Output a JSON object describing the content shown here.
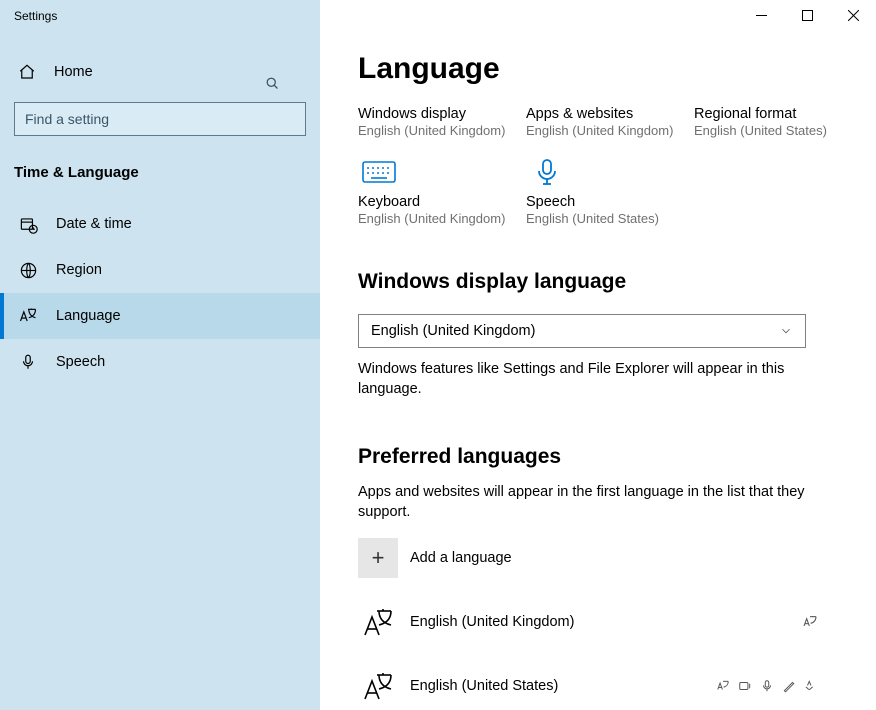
{
  "window_title": "Settings",
  "sidebar": {
    "home_label": "Home",
    "search_placeholder": "Find a setting",
    "section_title": "Time & Language",
    "items": [
      {
        "label": "Date & time"
      },
      {
        "label": "Region"
      },
      {
        "label": "Language"
      },
      {
        "label": "Speech"
      }
    ]
  },
  "page": {
    "title": "Language",
    "tiles": {
      "windows_display": {
        "title": "Windows display",
        "sub": "English (United Kingdom)"
      },
      "apps_websites": {
        "title": "Apps & websites",
        "sub": "English (United Kingdom)"
      },
      "regional_format": {
        "title": "Regional format",
        "sub": "English (United States)"
      },
      "keyboard": {
        "title": "Keyboard",
        "sub": "English (United Kingdom)"
      },
      "speech": {
        "title": "Speech",
        "sub": "English (United States)"
      }
    },
    "display_lang": {
      "heading": "Windows display language",
      "selected": "English (United Kingdom)",
      "help": "Windows features like Settings and File Explorer will appear in this language."
    },
    "preferred": {
      "heading": "Preferred languages",
      "help": "Apps and websites will appear in the first language in the list that they support.",
      "add_label": "Add a language",
      "items": [
        {
          "label": "English (United Kingdom)"
        },
        {
          "label": "English (United States)"
        }
      ]
    }
  }
}
